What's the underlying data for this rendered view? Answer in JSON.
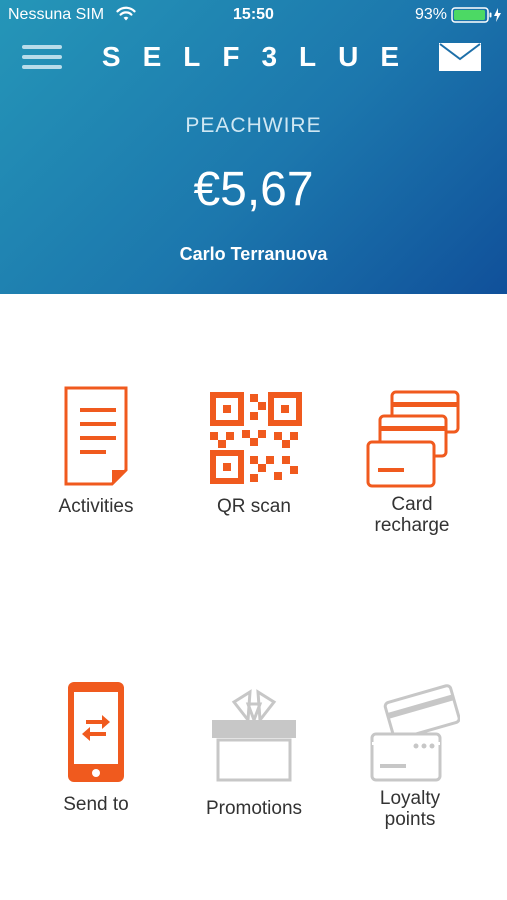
{
  "status_bar": {
    "carrier": "Nessuna SIM",
    "time": "15:50",
    "battery_percent": "93%"
  },
  "nav": {
    "brand": "SELF3LUE",
    "menu_icon": "hamburger-menu-icon",
    "mail_icon": "mail-envelope-icon"
  },
  "account": {
    "merchant": "PEACHWIRE",
    "balance": "€5,67",
    "user_name": "Carlo Terranuova"
  },
  "actions": [
    {
      "label": "Activities",
      "icon": "document-list-icon",
      "enabled": true
    },
    {
      "label": "QR scan",
      "icon": "qr-code-icon",
      "enabled": true
    },
    {
      "label": "Card\nrecharge",
      "icon": "card-stack-icon",
      "enabled": true
    },
    {
      "label": "Send to",
      "icon": "phone-transfer-icon",
      "enabled": true
    },
    {
      "label": "Promotions",
      "icon": "gift-box-icon",
      "enabled": false
    },
    {
      "label": "Loyalty\npoints",
      "icon": "loyalty-cards-icon",
      "enabled": false
    }
  ],
  "colors": {
    "accent_orange": "#f05a1e",
    "disabled_gray": "#c7c7c7",
    "header_start": "#2596b8",
    "header_end": "#10509a",
    "battery_green": "#4cd964"
  }
}
